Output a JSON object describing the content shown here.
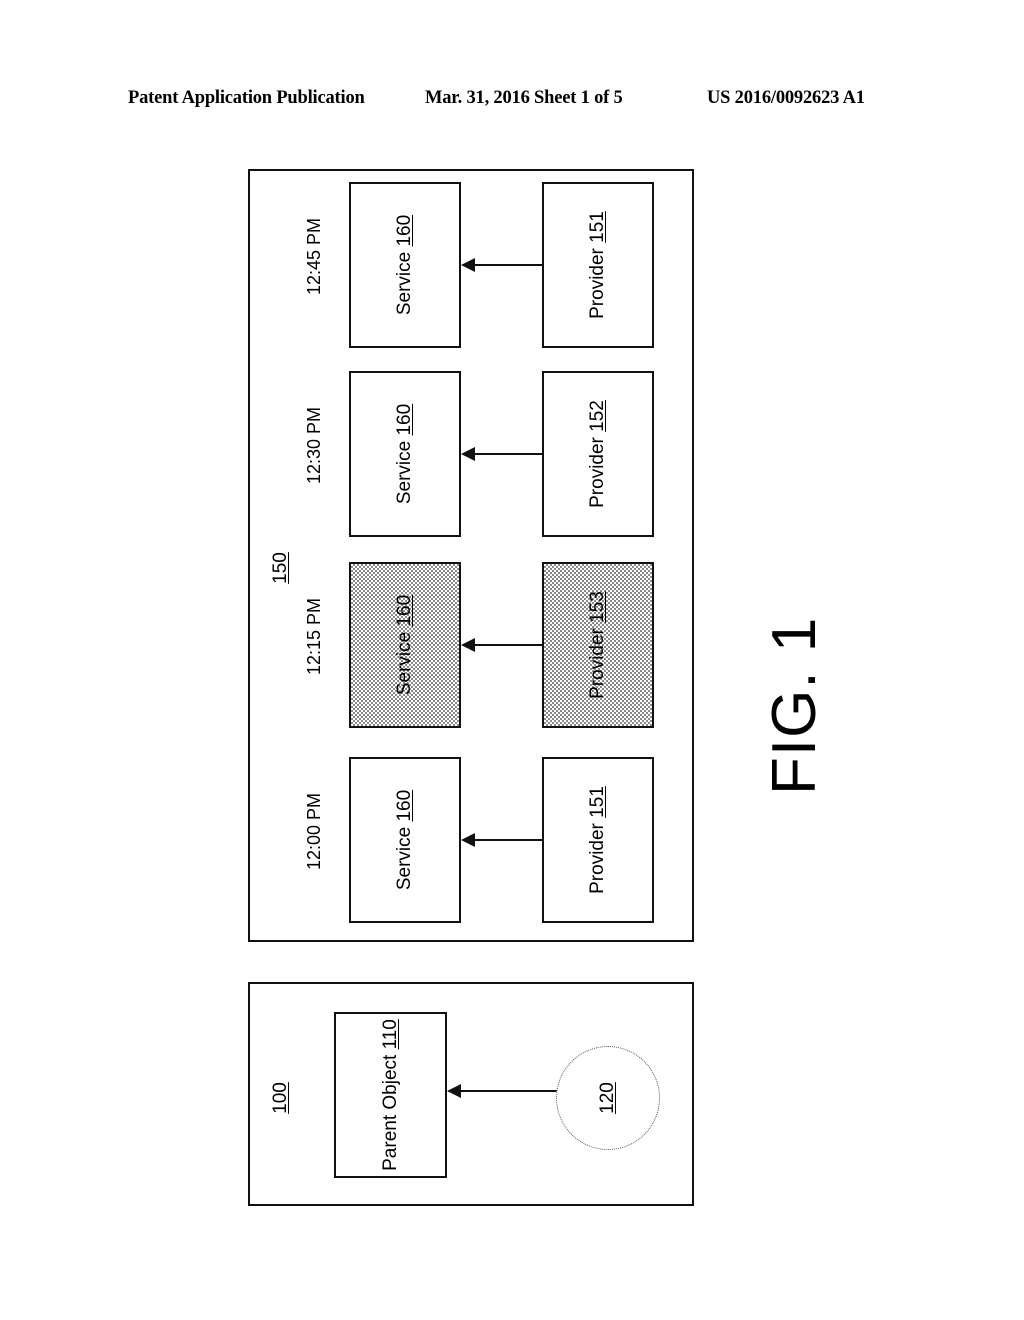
{
  "header": {
    "publication": "Patent Application Publication",
    "date_sheet": "Mar. 31, 2016  Sheet 1 of 5",
    "patent_number": "US 2016/0092623 A1"
  },
  "figure": {
    "caption": "FIG. 1"
  },
  "panels": {
    "schedule": {
      "ref": "150",
      "rows": [
        {
          "time": "12:45 PM",
          "service": {
            "label": "Service",
            "ref": "160"
          },
          "provider": {
            "label": "Provider",
            "ref": "151"
          },
          "shaded": false
        },
        {
          "time": "12:30 PM",
          "service": {
            "label": "Service",
            "ref": "160"
          },
          "provider": {
            "label": "Provider",
            "ref": "152"
          },
          "shaded": false
        },
        {
          "time": "12:15 PM",
          "service": {
            "label": "Service",
            "ref": "160"
          },
          "provider": {
            "label": "Provider",
            "ref": "153"
          },
          "shaded": true
        },
        {
          "time": "12:00 PM",
          "service": {
            "label": "Service",
            "ref": "160"
          },
          "provider": {
            "label": "Provider",
            "ref": "151"
          },
          "shaded": false
        }
      ]
    },
    "object": {
      "ref": "100",
      "parent_object": {
        "label": "Parent Object",
        "ref": "110"
      },
      "event": {
        "ref": "120"
      }
    }
  },
  "colors": {
    "ink": "#111111",
    "paper": "#ffffff",
    "shade": "#8a8a8a"
  }
}
